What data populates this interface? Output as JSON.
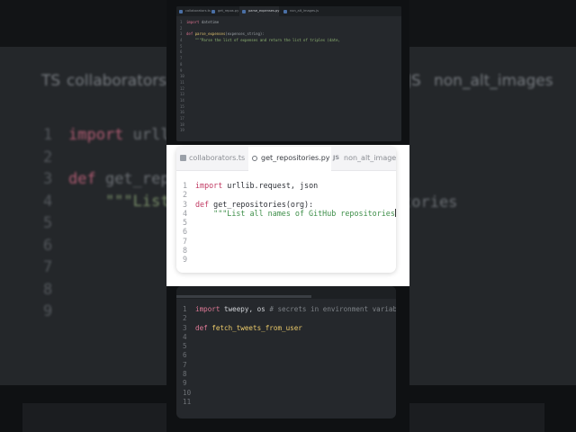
{
  "background_editor": {
    "tabs": [
      "collaborators.ts",
      "non_alt_images"
    ],
    "tab_icon_ts": "TS",
    "tab_icon_js": "JS",
    "lines": [
      {
        "num": "1",
        "kw": "import",
        "text": " urll"
      },
      {
        "num": "2",
        "kw": "",
        "text": ""
      },
      {
        "num": "3",
        "kw": "def",
        "text": " get_repo"
      },
      {
        "num": "4",
        "kw": "",
        "text": "    \"\"\"List"
      },
      {
        "num": "5",
        "kw": "",
        "text": ""
      },
      {
        "num": "6",
        "kw": "",
        "text": ""
      },
      {
        "num": "7",
        "kw": "",
        "text": ""
      },
      {
        "num": "8",
        "kw": "",
        "text": ""
      },
      {
        "num": "9",
        "kw": "",
        "text": ""
      }
    ],
    "right_text": "tories"
  },
  "mini_editor": {
    "tabs": [
      "collaborators.ts",
      "get_repos.py",
      "parse_expenses.py",
      "non_alt_images.js"
    ],
    "active_tab": 2,
    "lines": [
      {
        "num": "1",
        "kw": "import",
        "fn": "",
        "rest": " datetime",
        "str": ""
      },
      {
        "num": "2",
        "kw": "",
        "fn": "",
        "rest": "",
        "str": ""
      },
      {
        "num": "3",
        "kw": "def",
        "fn": " parse_expenses",
        "rest": "(expenses_string):",
        "str": ""
      },
      {
        "num": "4",
        "kw": "",
        "fn": "",
        "rest": "    ",
        "str": "\"\"\"Parse the list of expenses and return the list of triples (date,"
      },
      {
        "num": "5",
        "kw": "",
        "fn": "",
        "rest": "",
        "str": ""
      },
      {
        "num": "6",
        "kw": "",
        "fn": "",
        "rest": "",
        "str": ""
      },
      {
        "num": "7",
        "kw": "",
        "fn": "",
        "rest": "",
        "str": ""
      },
      {
        "num": "8",
        "kw": "",
        "fn": "",
        "rest": "",
        "str": ""
      },
      {
        "num": "9",
        "kw": "",
        "fn": "",
        "rest": "",
        "str": ""
      },
      {
        "num": "10",
        "kw": "",
        "fn": "",
        "rest": "",
        "str": ""
      },
      {
        "num": "11",
        "kw": "",
        "fn": "",
        "rest": "",
        "str": ""
      },
      {
        "num": "12",
        "kw": "",
        "fn": "",
        "rest": "",
        "str": ""
      },
      {
        "num": "13",
        "kw": "",
        "fn": "",
        "rest": "",
        "str": ""
      },
      {
        "num": "14",
        "kw": "",
        "fn": "",
        "rest": "",
        "str": ""
      },
      {
        "num": "15",
        "kw": "",
        "fn": "",
        "rest": "",
        "str": ""
      },
      {
        "num": "16",
        "kw": "",
        "fn": "",
        "rest": "",
        "str": ""
      },
      {
        "num": "17",
        "kw": "",
        "fn": "",
        "rest": "",
        "str": ""
      },
      {
        "num": "18",
        "kw": "",
        "fn": "",
        "rest": "",
        "str": ""
      },
      {
        "num": "19",
        "kw": "",
        "fn": "",
        "rest": "",
        "str": ""
      }
    ]
  },
  "main_editor": {
    "tabs": [
      {
        "label": "collaborators.ts",
        "icon": "ts-file-icon"
      },
      {
        "label": "get_repositories.py",
        "icon": "python-file-icon"
      },
      {
        "label": "non_alt_images",
        "icon": "js-file-icon",
        "icon_text": "JS"
      }
    ],
    "active_tab": 1,
    "lines": [
      {
        "num": "1",
        "kw": "import",
        "fn": "",
        "rest": " urllib.request, json",
        "str": ""
      },
      {
        "num": "2",
        "kw": "",
        "fn": "",
        "rest": "",
        "str": ""
      },
      {
        "num": "3",
        "kw": "def",
        "fn": " get_repositories",
        "rest": "(org):",
        "str": ""
      },
      {
        "num": "4",
        "kw": "",
        "fn": "",
        "rest": "    ",
        "str": "\"\"\"List all names of GitHub repositories"
      },
      {
        "num": "5",
        "kw": "",
        "fn": "",
        "rest": "",
        "str": ""
      },
      {
        "num": "6",
        "kw": "",
        "fn": "",
        "rest": "",
        "str": ""
      },
      {
        "num": "7",
        "kw": "",
        "fn": "",
        "rest": "",
        "str": ""
      },
      {
        "num": "8",
        "kw": "",
        "fn": "",
        "rest": "",
        "str": ""
      },
      {
        "num": "9",
        "kw": "",
        "fn": "",
        "rest": "",
        "str": ""
      }
    ]
  },
  "bottom_editor": {
    "lines": [
      {
        "num": "1",
        "kw": "import",
        "fn": "",
        "rest": " tweepy, os ",
        "cm": "# secrets in environment variables"
      },
      {
        "num": "2",
        "kw": "",
        "fn": "",
        "rest": "",
        "cm": ""
      },
      {
        "num": "3",
        "kw": "def",
        "fn": " fetch_tweets_from_user",
        "rest": "",
        "cm": ""
      },
      {
        "num": "4",
        "kw": "",
        "fn": "",
        "rest": "",
        "cm": ""
      },
      {
        "num": "5",
        "kw": "",
        "fn": "",
        "rest": "",
        "cm": ""
      },
      {
        "num": "6",
        "kw": "",
        "fn": "",
        "rest": "",
        "cm": ""
      },
      {
        "num": "7",
        "kw": "",
        "fn": "",
        "rest": "",
        "cm": ""
      },
      {
        "num": "8",
        "kw": "",
        "fn": "",
        "rest": "",
        "cm": ""
      },
      {
        "num": "9",
        "kw": "",
        "fn": "",
        "rest": "",
        "cm": ""
      },
      {
        "num": "10",
        "kw": "",
        "fn": "",
        "rest": "",
        "cm": ""
      },
      {
        "num": "11",
        "kw": "",
        "fn": "",
        "rest": "",
        "cm": ""
      }
    ]
  }
}
